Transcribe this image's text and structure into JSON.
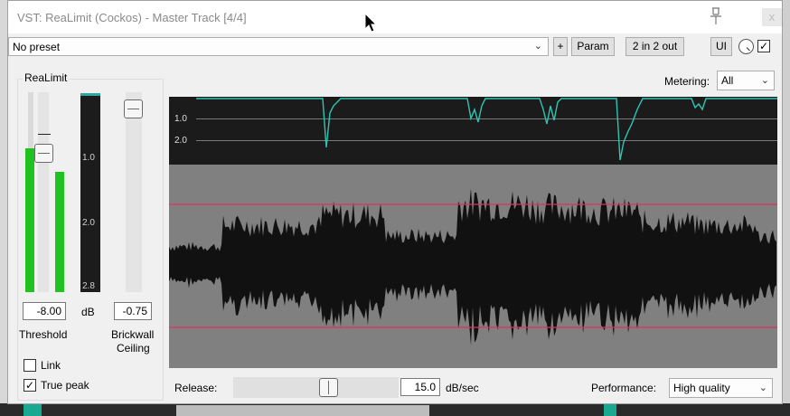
{
  "window": {
    "title": "VST: ReaLimit (Cockos) - Master Track [4/4]",
    "close_label": "x"
  },
  "toolbar": {
    "preset_value": "No preset",
    "plus_label": "+",
    "param_label": "Param",
    "io_label": "2 in 2 out",
    "ui_label": "UI",
    "bypass_checked": true
  },
  "group": {
    "title": "ReaLimit"
  },
  "threshold": {
    "value": "-8.00",
    "unit": "dB",
    "label": "Threshold",
    "meter_left_level": 0.72,
    "meter_right_level": 0.6
  },
  "ceiling": {
    "value": "-0.75",
    "label_line1": "Brickwall",
    "label_line2": "Ceiling"
  },
  "gr_meter": {
    "ticks": [
      "1.0",
      "2.0",
      "2.8"
    ]
  },
  "options": {
    "link_label": "Link",
    "link_checked": false,
    "truepeak_label": "True peak",
    "truepeak_checked": true
  },
  "metering": {
    "label": "Metering:",
    "value": "All"
  },
  "display": {
    "gr_ticks": [
      "1.0",
      "2.0"
    ]
  },
  "release": {
    "label": "Release:",
    "value": "15.0",
    "unit": "dB/sec"
  },
  "performance": {
    "label": "Performance:",
    "value": "High quality"
  },
  "colors": {
    "meter_green": "#1fc21f",
    "gr_line": "#2fc4b2",
    "threshold_line": "#e03060",
    "waveform": "#111111",
    "waveform_bg": "#808080"
  }
}
